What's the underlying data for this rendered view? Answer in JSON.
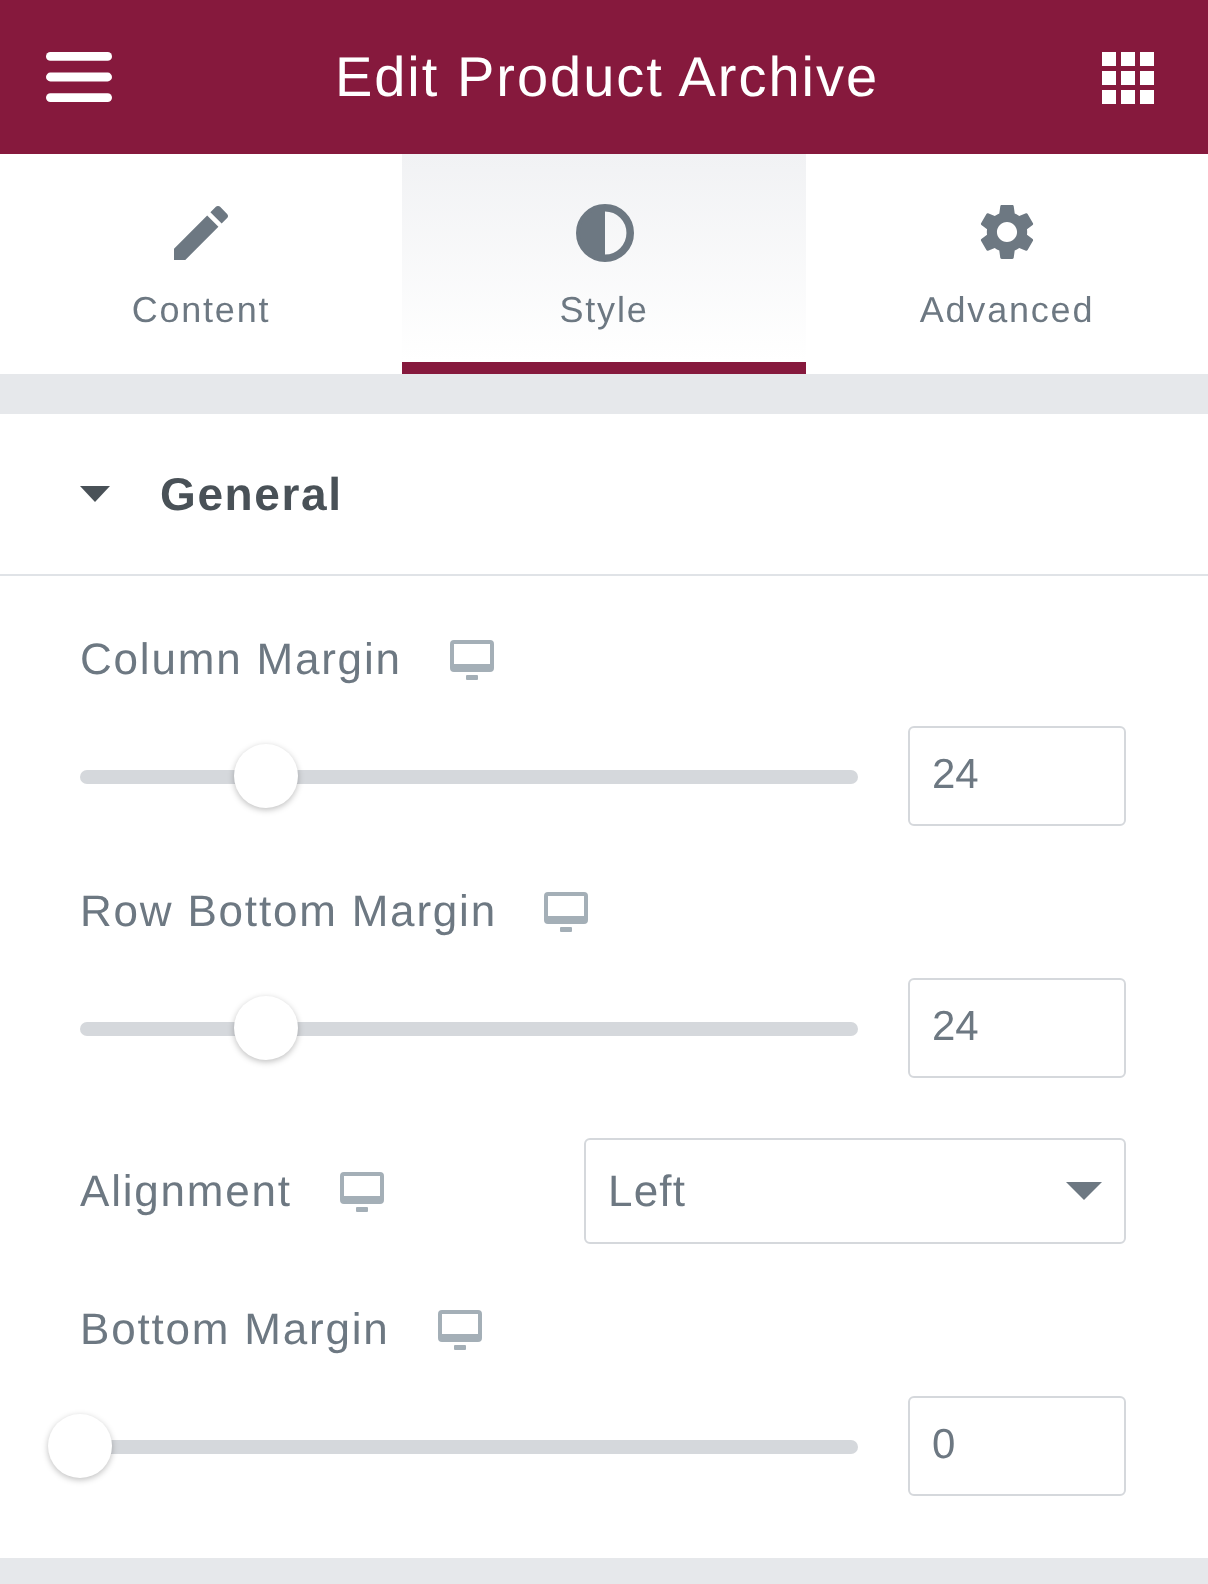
{
  "header": {
    "title": "Edit Product Archive"
  },
  "tabs": [
    {
      "label": "Content",
      "selected": false
    },
    {
      "label": "Style",
      "selected": true
    },
    {
      "label": "Advanced",
      "selected": false
    }
  ],
  "section": {
    "title": "General",
    "expanded": true,
    "controls": [
      {
        "kind": "slider",
        "label": "Column Margin",
        "level": 0.24,
        "value": "24"
      },
      {
        "kind": "slider",
        "label": "Row Bottom Margin",
        "level": 0.24,
        "value": "24"
      },
      {
        "kind": "select",
        "label": "Alignment",
        "value": "Left"
      },
      {
        "kind": "slider",
        "label": "Bottom Margin",
        "level": 0,
        "value": "0"
      }
    ]
  }
}
